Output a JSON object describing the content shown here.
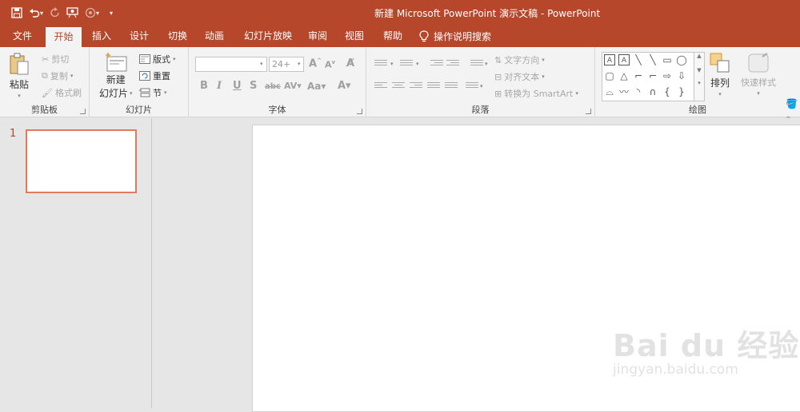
{
  "title": {
    "text": "新建 Microsoft PowerPoint 演示文稿 - PowerPoint"
  },
  "colors": {
    "accent": "#b7472a",
    "ribbon_bg": "#f3f3f3",
    "workspace_bg": "#e6e6e6",
    "thumb_border": "#e07b5d"
  },
  "quick_access": {
    "icons": [
      "save-icon",
      "undo-icon",
      "redo-icon",
      "start-slideshow-icon",
      "touch-mode-icon",
      "customize-icon"
    ]
  },
  "tabs": [
    {
      "label": "文件"
    },
    {
      "label": "开始"
    },
    {
      "label": "插入"
    },
    {
      "label": "设计"
    },
    {
      "label": "切换"
    },
    {
      "label": "动画"
    },
    {
      "label": "幻灯片放映"
    },
    {
      "label": "审阅"
    },
    {
      "label": "视图"
    },
    {
      "label": "帮助"
    }
  ],
  "tell_me": {
    "label": "操作说明搜索"
  },
  "clipboard": {
    "paste": "粘贴",
    "cut": "剪切",
    "copy": "复制",
    "format_painter": "格式刷",
    "group_label": "剪贴板"
  },
  "slides_group": {
    "new_slide_line1": "新建",
    "new_slide_line2": "幻灯片",
    "layout": "版式",
    "reset": "重置",
    "section": "节",
    "group_label": "幻灯片"
  },
  "font": {
    "font_name": "",
    "font_size": "24+",
    "group_label": "字体"
  },
  "paragraph": {
    "text_direction": "文字方向",
    "align_text": "对齐文本",
    "convert_smartart": "转换为 SmartArt",
    "group_label": "段落"
  },
  "drawing": {
    "arrange": "排列",
    "quick_styles": "快速样式",
    "group_label": "绘图"
  },
  "slide_panel": {
    "slide_number": "1"
  },
  "watermark": {
    "brand": "Bai du 经验",
    "url": "jingyan.baidu.com"
  }
}
